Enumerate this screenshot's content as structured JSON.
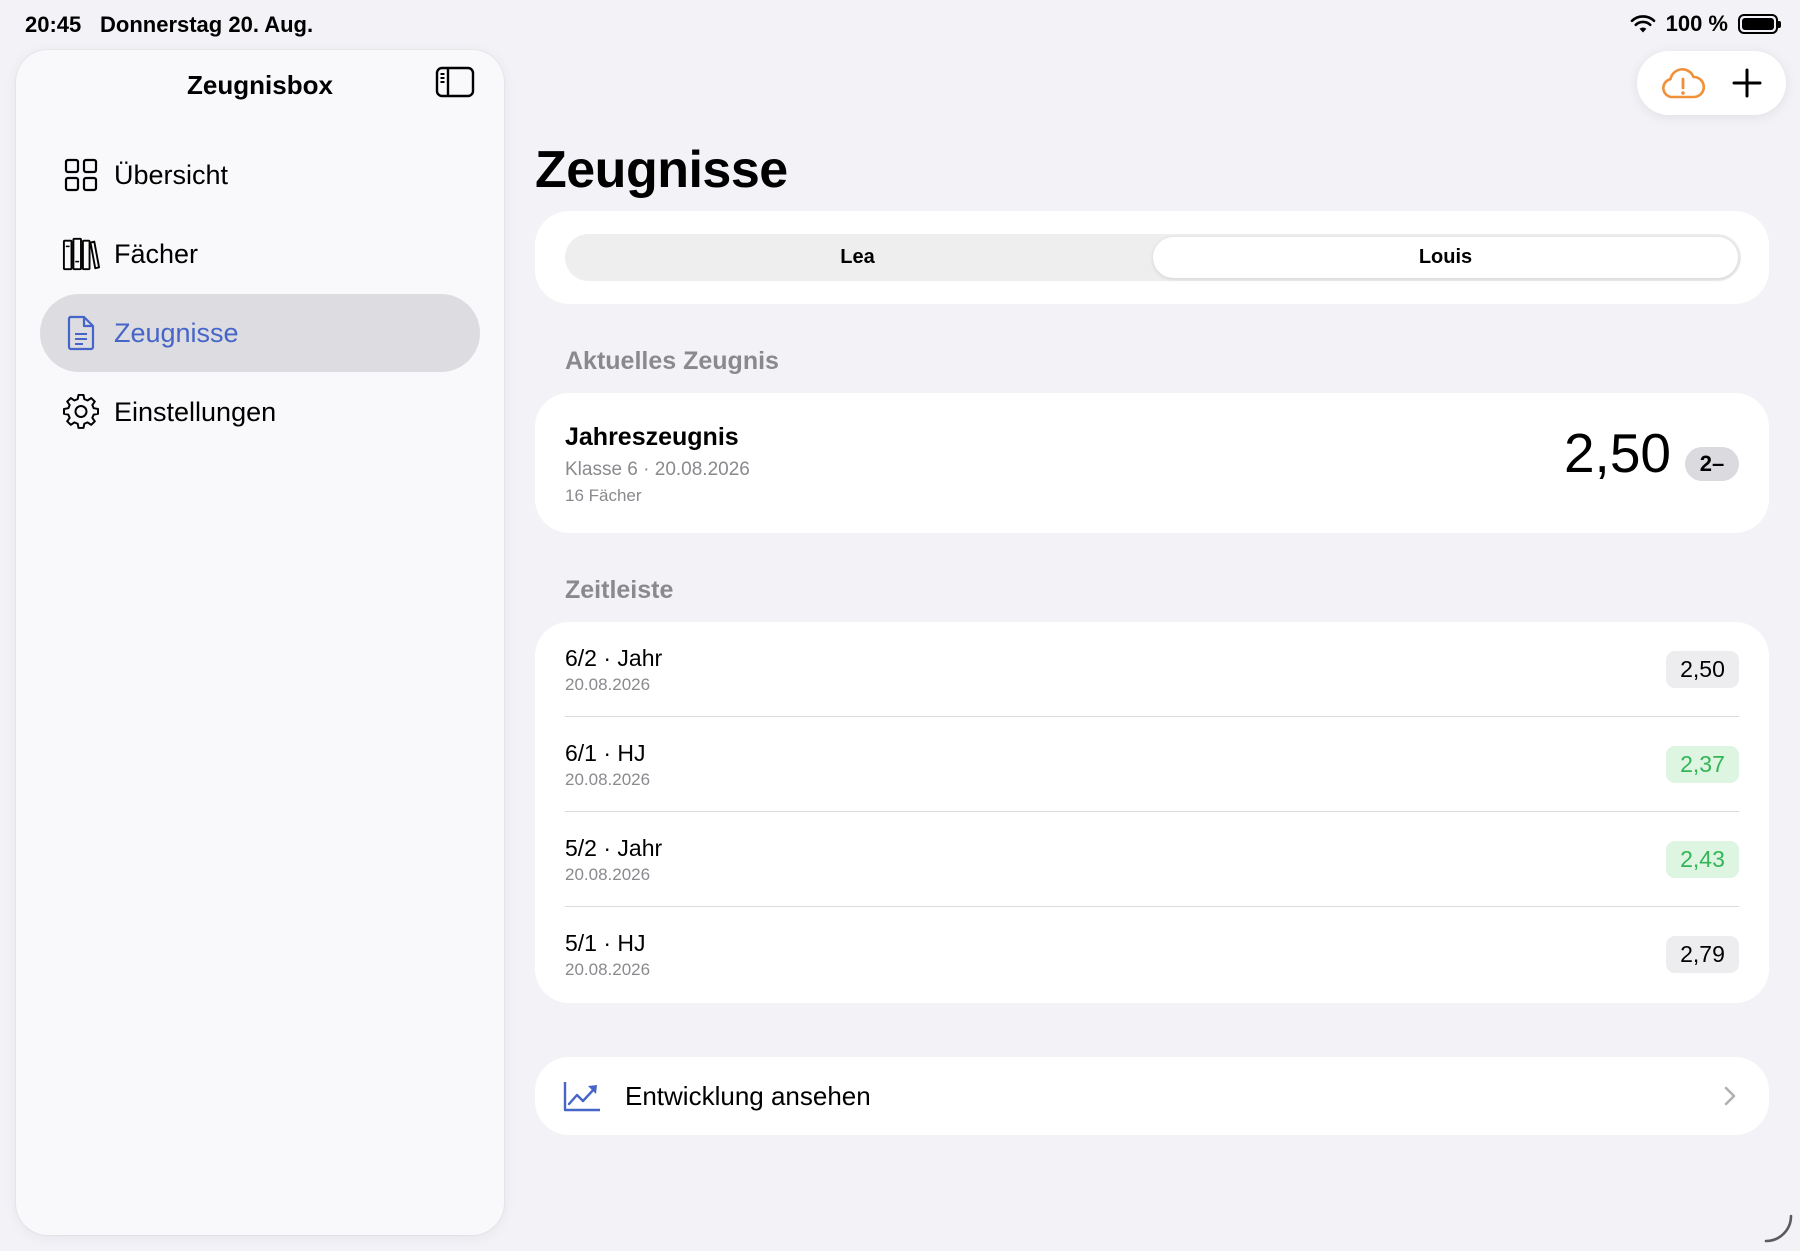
{
  "status_bar": {
    "time": "20:45",
    "date": "Donnerstag 20. Aug.",
    "battery": "100 %"
  },
  "sidebar": {
    "title": "Zeugnisbox",
    "items": [
      {
        "label": "Übersicht",
        "icon": "grid-icon"
      },
      {
        "label": "Fächer",
        "icon": "books-icon"
      },
      {
        "label": "Zeugnisse",
        "icon": "document-icon",
        "active": true
      },
      {
        "label": "Einstellungen",
        "icon": "gear-icon"
      }
    ]
  },
  "main": {
    "title": "Zeugnisse",
    "students": {
      "options": [
        "Lea",
        "Louis"
      ],
      "selected": "Louis"
    },
    "current_section": "Aktuelles Zeugnis",
    "current": {
      "title": "Jahreszeugnis",
      "subtitle": "Klasse 6 · 20.08.2026",
      "count": "16 Fächer",
      "grade": "2,50",
      "grade_badge": "2–"
    },
    "timeline_section": "Zeitleiste",
    "timeline": [
      {
        "title": "6/2 · Jahr",
        "date": "20.08.2026",
        "grade": "2,50",
        "good": false
      },
      {
        "title": "6/1 · HJ",
        "date": "20.08.2026",
        "grade": "2,37",
        "good": true
      },
      {
        "title": "5/2 · Jahr",
        "date": "20.08.2026",
        "grade": "2,43",
        "good": true
      },
      {
        "title": "5/1 · HJ",
        "date": "20.08.2026",
        "grade": "2,79",
        "good": false
      }
    ],
    "development_label": "Entwicklung ansehen"
  },
  "colors": {
    "accent": "#4565c8",
    "good_text": "#34b558",
    "good_bg": "#ddf5e1",
    "warning": "#f0913a"
  }
}
